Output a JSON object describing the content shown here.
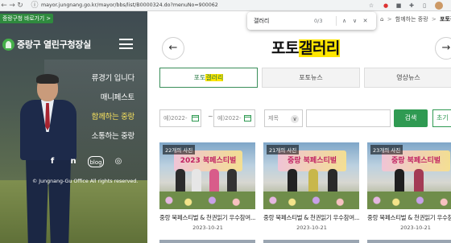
{
  "browser": {
    "url": "mayor.jungnang.go.kr/mayor/bbs/list/B0000324.do?menuNo=900062",
    "nav_back": "←",
    "nav_forward": "→",
    "nav_reload": "↻",
    "info_icon": "ⓘ"
  },
  "find": {
    "query": "갤러리",
    "count": "0/3",
    "prev": "∧",
    "next": "∨",
    "close": "✕"
  },
  "hero": {
    "badge": "중랑구청 바로가기 >",
    "brand": "중랑구 열린구청장실",
    "menu": [
      "류경기 입니다",
      "매니페스토",
      "함께하는 중랑",
      "소통하는 중랑"
    ],
    "active_menu_index": 2,
    "social": [
      "f",
      "n",
      "blog",
      "◎"
    ],
    "copyright": "© Jungnang-Gu Office All rights reserved."
  },
  "breadcrumb": {
    "home": "⌂",
    "parent": "함께하는 중랑",
    "current": "포토갤러리"
  },
  "page": {
    "title_plain": "포토",
    "title_highlight": "갤러리",
    "prev_arrow": "←",
    "next_arrow": "→"
  },
  "tabs": [
    {
      "plain": "포토",
      "highlight": "갤러리",
      "active": true
    },
    {
      "plain": "포토뉴스",
      "highlight": "",
      "active": false
    },
    {
      "plain": "영상뉴스",
      "highlight": "",
      "active": false
    }
  ],
  "search": {
    "start_date_placeholder": "예)2022-",
    "end_date_placeholder": "예)2022-",
    "tilde": "~",
    "field_select": "제목",
    "select_arrow": "∨",
    "search_label": "검색",
    "reset_label": "초기"
  },
  "cards": [
    {
      "count": "22개의 사진",
      "title": "중랑 북페스티벌 & 천권읽기 우수참여...",
      "date": "2023-10-21",
      "banner": "2023 북페스티벌"
    },
    {
      "count": "21개의 사진",
      "title": "중랑 북페스티벌 & 천권읽기 우수참여...",
      "date": "2023-10-21",
      "banner": "중랑 북페스티벌"
    },
    {
      "count": "23개의 사진",
      "title": "중랑 북페스티벌 & 천권읽기 우수참여...",
      "date": "2023-10-21",
      "banner": "중랑 북페스티벌"
    }
  ],
  "colors": {
    "accent_green": "#2f9a52",
    "highlight_yellow": "#ffe600",
    "active_menu": "#f6e05e"
  }
}
